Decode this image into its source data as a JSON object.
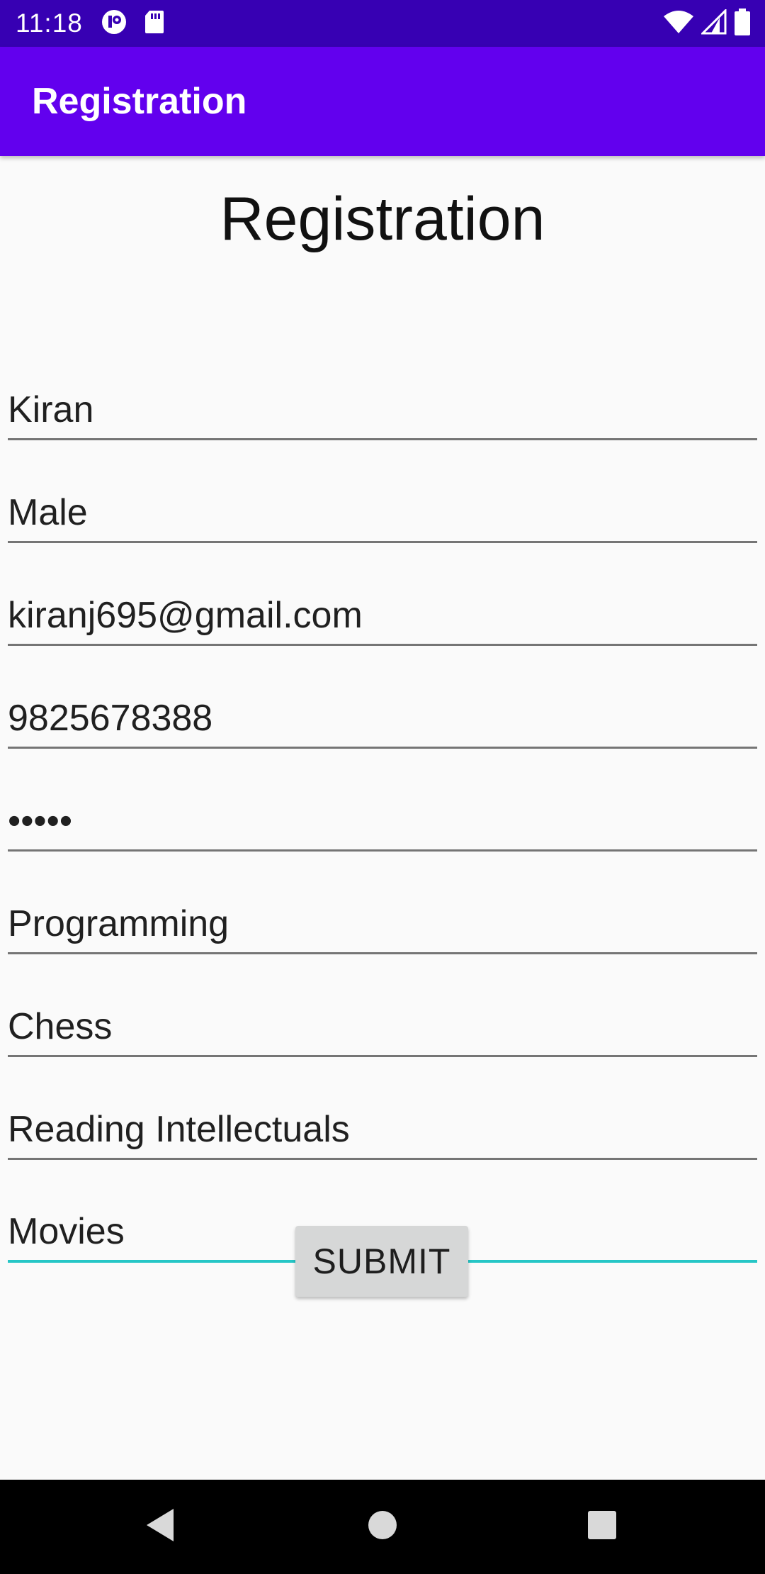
{
  "status_bar": {
    "time": "11:18",
    "icons": [
      "app-notification-icon",
      "sd-card-icon",
      "wifi-icon",
      "signal-icon",
      "battery-icon"
    ]
  },
  "app_bar": {
    "title": "Registration"
  },
  "form": {
    "heading": "Registration",
    "fields": [
      {
        "value": "Kiran"
      },
      {
        "value": "Male"
      },
      {
        "value": "kiranj695@gmail.com"
      },
      {
        "value": "9825678388"
      },
      {
        "value": "•••••"
      },
      {
        "value": "Programming"
      },
      {
        "value": "Chess"
      },
      {
        "value": "Reading Intellectuals"
      },
      {
        "value": "Movies"
      }
    ],
    "submit_label": "SUBMIT"
  },
  "nav_bar": {
    "icons": [
      "back-icon",
      "home-icon",
      "recents-icon"
    ]
  },
  "colors": {
    "status_bar": "#3700b3",
    "app_bar": "#6200ee",
    "focused_underline": "#26c6c6",
    "background": "#fafafa",
    "button": "#d6d7d7"
  }
}
